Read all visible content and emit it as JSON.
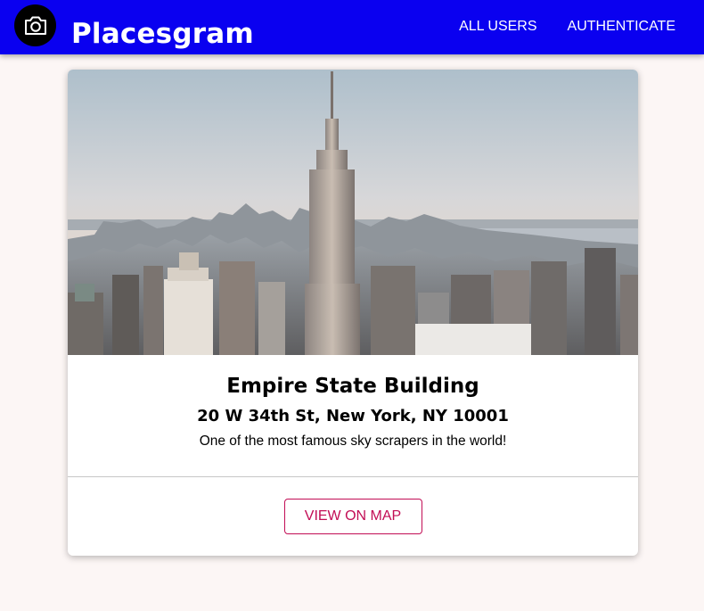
{
  "header": {
    "brand": "Placesgram",
    "logo_icon": "camera-icon",
    "nav": [
      {
        "label": "ALL USERS"
      },
      {
        "label": "AUTHENTICATE"
      }
    ],
    "background": "#0a00f0"
  },
  "place": {
    "image_subject": "Empire State Building over the Manhattan skyline",
    "title": "Empire State Building",
    "address": "20 W 34th St, New York, NY 10001",
    "description": "One of the most famous sky scrapers in the world!",
    "view_on_map_label": "VIEW ON MAP"
  },
  "colors": {
    "accent": "#c20d55",
    "page_background": "#fcf6f5"
  }
}
